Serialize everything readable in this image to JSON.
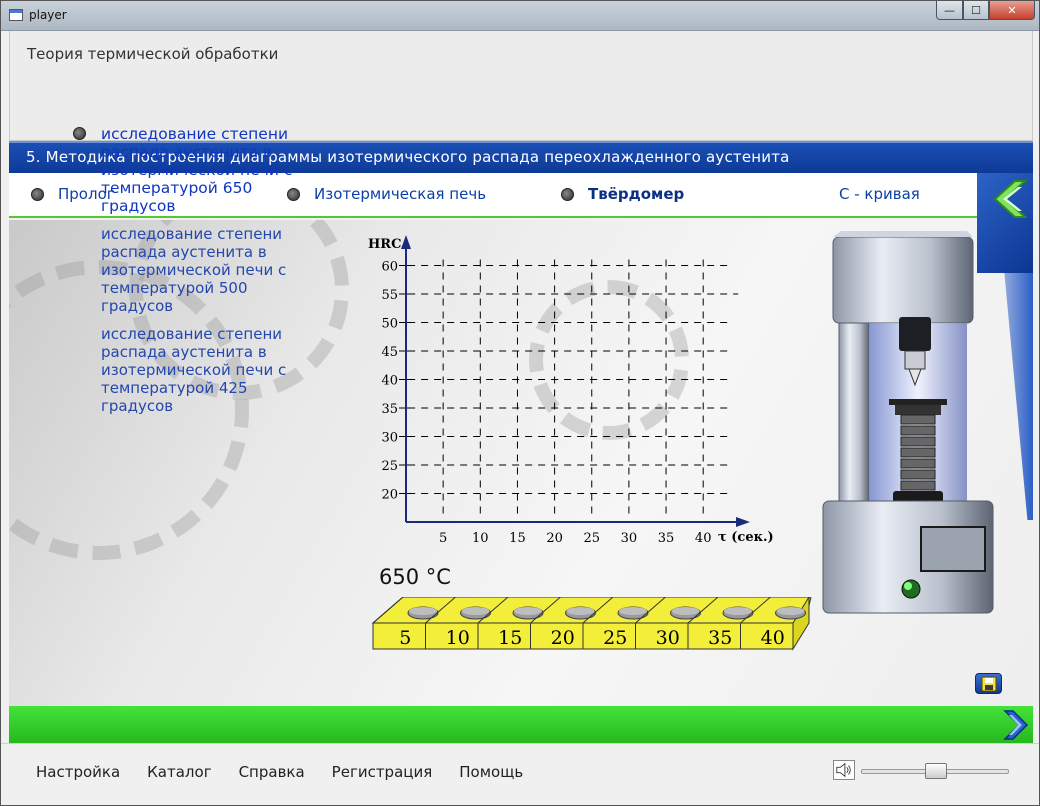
{
  "window": {
    "title": "player",
    "min": "—",
    "max": "☐",
    "close": "✕"
  },
  "course": {
    "title": "Теория термической обработки"
  },
  "section": {
    "title": "5. Методика построения диаграммы изотермического распада переохлажденного аустенита"
  },
  "nav": {
    "items": [
      {
        "label": "Пролог"
      },
      {
        "label": "Изотермическая печь"
      },
      {
        "label": "Твёрдомер"
      },
      {
        "label": "С - кривая"
      }
    ]
  },
  "menu": {
    "items": [
      {
        "label": "исследование степени распада аустенита в изотермической печи с температурой 650 градусов"
      },
      {
        "label": "исследование степени распада аустенита в изотермической печи с температурой 500 градусов"
      },
      {
        "label": "исследование степени распада аустенита в изотермической печи с температурой 425 градусов"
      }
    ]
  },
  "chart_data": {
    "type": "scatter",
    "ylabel": "HRC",
    "xlabel": "τ (сек.)",
    "x_ticks": [
      5,
      10,
      15,
      20,
      25,
      30,
      35,
      40
    ],
    "y_ticks": [
      20,
      25,
      30,
      35,
      40,
      45,
      50,
      55,
      60
    ],
    "xlim": [
      0,
      45
    ],
    "ylim": [
      15,
      62
    ],
    "grid": true,
    "series": []
  },
  "experiment": {
    "temperature": "650 °C",
    "samples": [
      "5",
      "10",
      "15",
      "20",
      "25",
      "30",
      "35",
      "40"
    ]
  },
  "footer": {
    "menu": [
      "Настройка",
      "Каталог",
      "Справка",
      "Регистрация",
      "Помощь"
    ],
    "volume": 0.45
  },
  "colors": {
    "accent_blue": "#0d3a96",
    "accent_green": "#2ec524",
    "tray_yellow": "#f2ee3a"
  }
}
